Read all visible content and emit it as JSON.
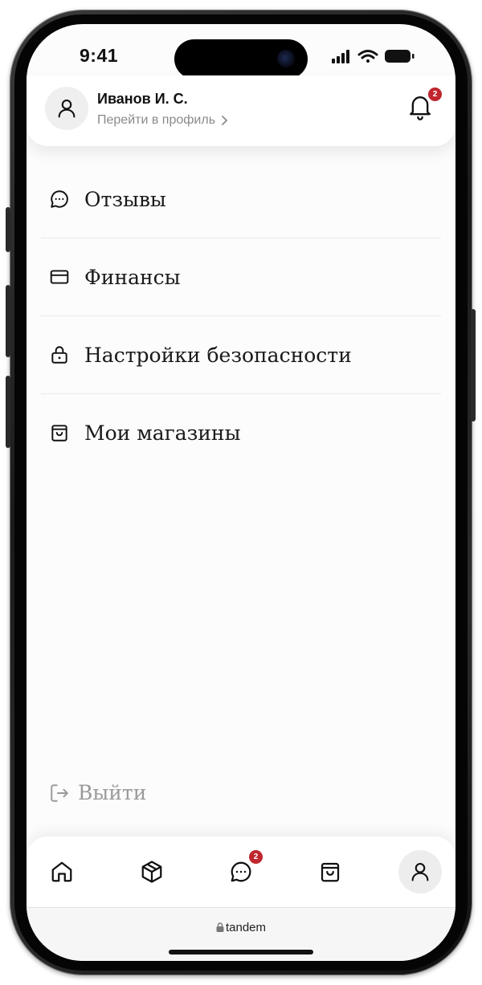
{
  "status_bar": {
    "time": "9:41"
  },
  "header": {
    "user_name": "Иванов И. С.",
    "profile_link": "Перейти в профиль",
    "notifications_count": "2"
  },
  "menu": {
    "items": [
      {
        "label": "Отзывы",
        "icon": "chat-bubble-icon"
      },
      {
        "label": "Финансы",
        "icon": "credit-card-icon"
      },
      {
        "label": "Настройки безопасности",
        "icon": "lock-icon"
      },
      {
        "label": "Мои магазины",
        "icon": "shopping-bag-icon"
      }
    ]
  },
  "logout": {
    "label": "Выйти",
    "icon": "logout-icon"
  },
  "tabbar": {
    "tabs": [
      {
        "name": "home",
        "icon": "home-icon"
      },
      {
        "name": "products",
        "icon": "box-icon"
      },
      {
        "name": "messages",
        "icon": "chat-bubble-icon",
        "badge": "2"
      },
      {
        "name": "shop",
        "icon": "shopping-bag-icon"
      },
      {
        "name": "profile",
        "icon": "user-icon",
        "active": true
      }
    ]
  },
  "browser": {
    "url": "tandem"
  },
  "colors": {
    "badge": "#c0262d",
    "text": "#1a1a1a",
    "muted": "#8a8a8a"
  }
}
